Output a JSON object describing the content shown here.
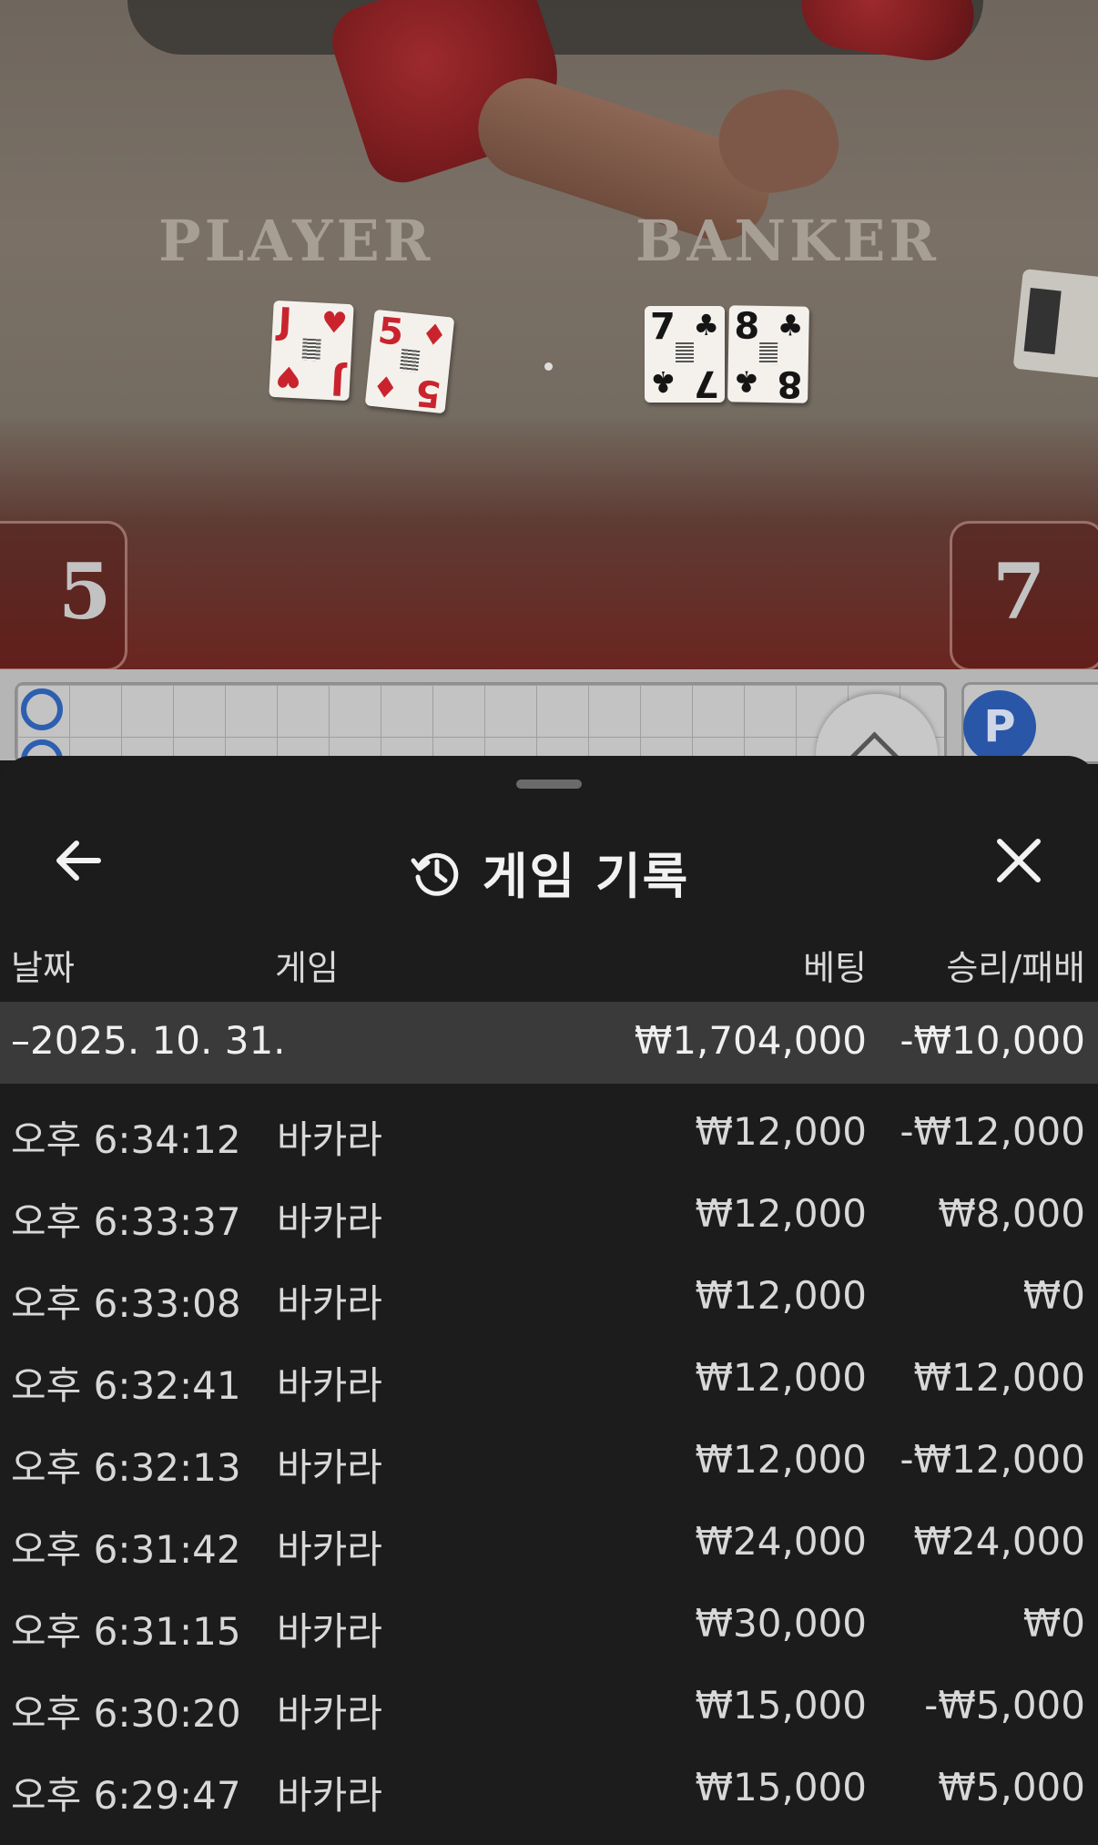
{
  "video": {
    "player_label": "PLAYER",
    "banker_label": "BANKER",
    "player_score": "5",
    "banker_score": "7",
    "player_cards": [
      {
        "rank": "J",
        "suit": "♥",
        "color": "red"
      },
      {
        "rank": "5",
        "suit": "♦",
        "color": "red"
      }
    ],
    "banker_cards": [
      {
        "rank": "7",
        "suit": "♣",
        "color": "black"
      },
      {
        "rank": "8",
        "suit": "♣",
        "color": "black"
      }
    ]
  },
  "road": {
    "badge_label": "P"
  },
  "sheet": {
    "title": "게임 기록",
    "columns": {
      "date": "날짜",
      "game": "게임",
      "bet": "베팅",
      "win_loss": "승리/패배"
    },
    "day_summary": {
      "date": "–2025. 10. 31.",
      "bet": "₩1,704,000",
      "win_loss": "-₩10,000"
    },
    "rows": [
      {
        "time": "오후 6:34:12",
        "game": "바카라",
        "bet": "₩12,000",
        "win_loss": "-₩12,000"
      },
      {
        "time": "오후 6:33:37",
        "game": "바카라",
        "bet": "₩12,000",
        "win_loss": "₩8,000"
      },
      {
        "time": "오후 6:33:08",
        "game": "바카라",
        "bet": "₩12,000",
        "win_loss": "₩0"
      },
      {
        "time": "오후 6:32:41",
        "game": "바카라",
        "bet": "₩12,000",
        "win_loss": "₩12,000"
      },
      {
        "time": "오후 6:32:13",
        "game": "바카라",
        "bet": "₩12,000",
        "win_loss": "-₩12,000"
      },
      {
        "time": "오후 6:31:42",
        "game": "바카라",
        "bet": "₩24,000",
        "win_loss": "₩24,000"
      },
      {
        "time": "오후 6:31:15",
        "game": "바카라",
        "bet": "₩30,000",
        "win_loss": "₩0"
      },
      {
        "time": "오후 6:30:20",
        "game": "바카라",
        "bet": "₩15,000",
        "win_loss": "-₩5,000"
      },
      {
        "time": "오후 6:29:47",
        "game": "바카라",
        "bet": "₩15,000",
        "win_loss": "₩5,000"
      }
    ]
  }
}
